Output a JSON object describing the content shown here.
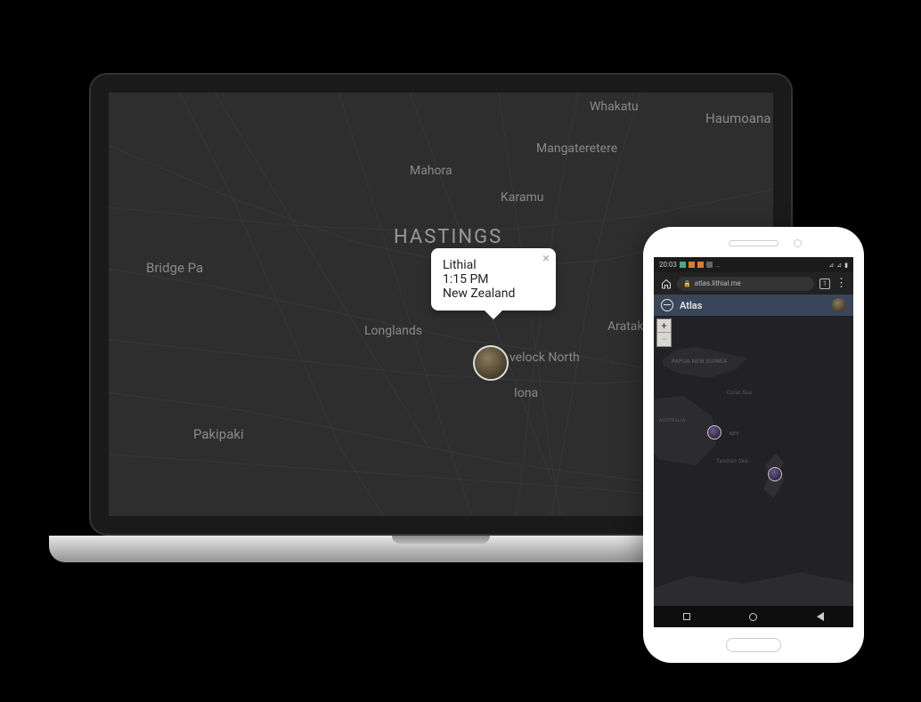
{
  "laptop": {
    "map": {
      "city": "HASTINGS",
      "labels": {
        "whakatu": "Whakatu",
        "haumoana": "Haumoana",
        "mangateretere": "Mangateretere",
        "mahora": "Mahora",
        "karamu": "Karamu",
        "bridgepa": "Bridge Pa",
        "longlands": "Longlands",
        "arataki": "Arataki",
        "havelock": "velock North",
        "iona": "Iona",
        "pakipaki": "Pakipaki"
      }
    },
    "popup": {
      "name": "Lithial",
      "time": "1:15 PM",
      "location": "New Zealand",
      "close": "×"
    }
  },
  "phone": {
    "statusbar": {
      "time": "20:03",
      "right": [
        "⋮",
        "⊿",
        "₪"
      ]
    },
    "browser": {
      "url": "atlas.lithial.me",
      "tabs": "1"
    },
    "app": {
      "title": "Atlas"
    },
    "map": {
      "zoom_in": "+",
      "zoom_out": "−",
      "labels": {
        "png": "PAPUA NEW GUINEA",
        "coral": "Coral Sea",
        "aus": "AUSTRALIA",
        "ney": "NEY",
        "tasman": "Tasman Sea"
      }
    }
  }
}
